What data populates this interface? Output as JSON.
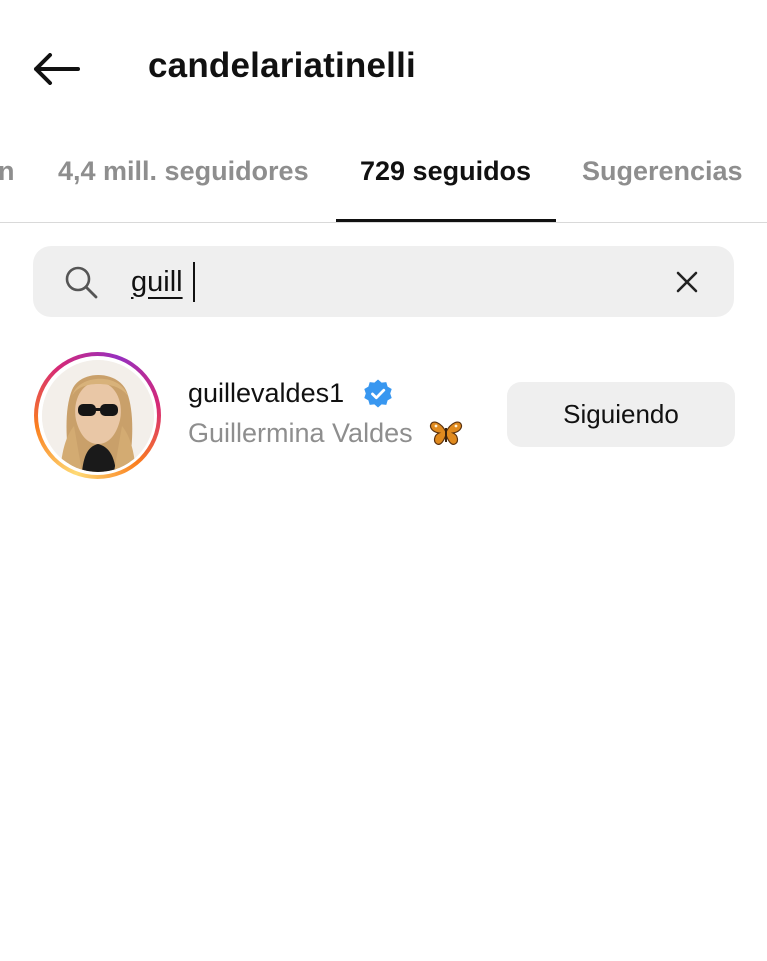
{
  "header": {
    "title": "candelariatinelli"
  },
  "tabs": {
    "partial_left": "n",
    "items": [
      {
        "label": "4,4 mill. seguidores",
        "active": false
      },
      {
        "label": "729 seguidos",
        "active": true
      },
      {
        "label": "Sugerencias",
        "active": false
      }
    ]
  },
  "search": {
    "value": "guill",
    "placeholder": ""
  },
  "results": [
    {
      "username": "guillevaldes1",
      "verified": true,
      "full_name": "Guillermina Valdes",
      "emoji": "butterfly",
      "button_label": "Siguiendo"
    }
  ],
  "colors": {
    "text_primary": "#111111",
    "text_secondary": "#8e8e8e",
    "surface": "#efefef",
    "verified_blue": "#3897f0"
  },
  "icons": [
    "back-arrow-icon",
    "search-icon",
    "close-icon",
    "verified-badge-icon",
    "butterfly-icon"
  ]
}
